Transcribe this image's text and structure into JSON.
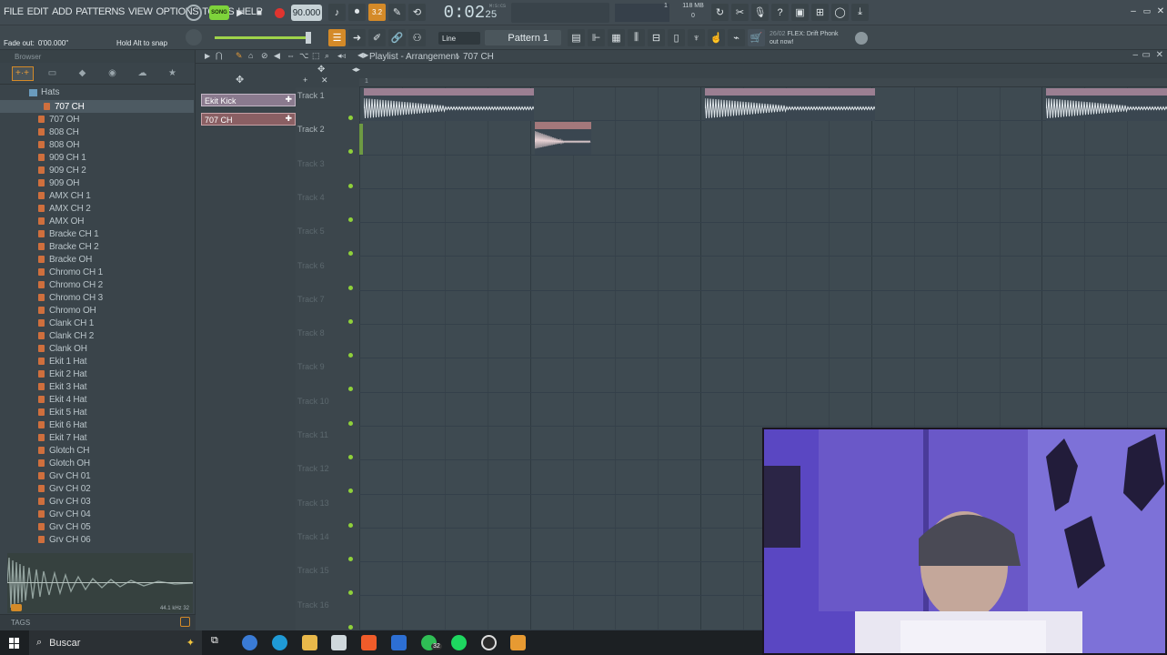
{
  "menu": [
    "FILE",
    "EDIT",
    "ADD",
    "PATTERNS",
    "VIEW",
    "OPTIONS",
    "TOOLS",
    "HELP"
  ],
  "transport": {
    "mode": "SONG",
    "tempo": "90.000",
    "time": "0:02",
    "time_small": "25",
    "time_unit": "M:S:CS",
    "memory": "118 MB",
    "cpu_top": "1",
    "cpu_bottom": "0"
  },
  "hint": {
    "left": "Fade out:",
    "value": "0'00.000\"",
    "right": "Hold Alt to snap"
  },
  "toolbar": {
    "snap": "Line",
    "pattern": "Pattern 1"
  },
  "news": {
    "date": "26/02",
    "line1": "FLEX: Drift Phonk",
    "line2": "out now!"
  },
  "browser": {
    "title": "Browser",
    "folder": "Hats",
    "items": [
      "707 CH",
      "707 OH",
      "808 CH",
      "808 OH",
      "909 CH 1",
      "909 CH 2",
      "909 OH",
      "AMX CH 1",
      "AMX CH 2",
      "AMX OH",
      "Bracke CH 1",
      "Bracke CH 2",
      "Bracke OH",
      "Chromo CH 1",
      "Chromo CH 2",
      "Chromo CH 3",
      "Chromo OH",
      "Clank CH 1",
      "Clank CH 2",
      "Clank OH",
      "Ekit 1 Hat",
      "Ekit 2 Hat",
      "Ekit 3 Hat",
      "Ekit 4 Hat",
      "Ekit 5 Hat",
      "Ekit 6 Hat",
      "Ekit 7 Hat",
      "Glotch CH",
      "Glotch OH",
      "Grv CH 01",
      "Grv CH 02",
      "Grv CH 03",
      "Grv CH 04",
      "Grv CH 05",
      "Grv CH 06"
    ],
    "selected": "707 CH",
    "sample_info": "44.1 kHz 32",
    "tags_label": "TAGS"
  },
  "picker": [
    "Ekit Kick",
    "707 CH"
  ],
  "playlist": {
    "title": "Playlist - Arrangement",
    "crumb": "707 CH",
    "ruler_start": "1",
    "tracks": [
      "Track 1",
      "Track 2",
      "Track 3",
      "Track 4",
      "Track 5",
      "Track 6",
      "Track 7",
      "Track 8",
      "Track 9",
      "Track 10",
      "Track 11",
      "Track 12",
      "Track 13",
      "Track 14",
      "Track 15",
      "Track 16"
    ],
    "clips": [
      {
        "name": "Ekit Kick",
        "track": 1
      },
      {
        "name": "707 CH",
        "track": 2
      },
      {
        "name": "Ekit Kick",
        "track": 1
      },
      {
        "name": "Ekit Kick",
        "track": 1
      }
    ]
  },
  "taskbar": {
    "search_placeholder": "Buscar",
    "badge": "32"
  },
  "colors": {
    "accent": "#e39a3a",
    "clip_header": "#9b7f92",
    "track_led": "#8fd13a",
    "record": "#e0342f"
  }
}
